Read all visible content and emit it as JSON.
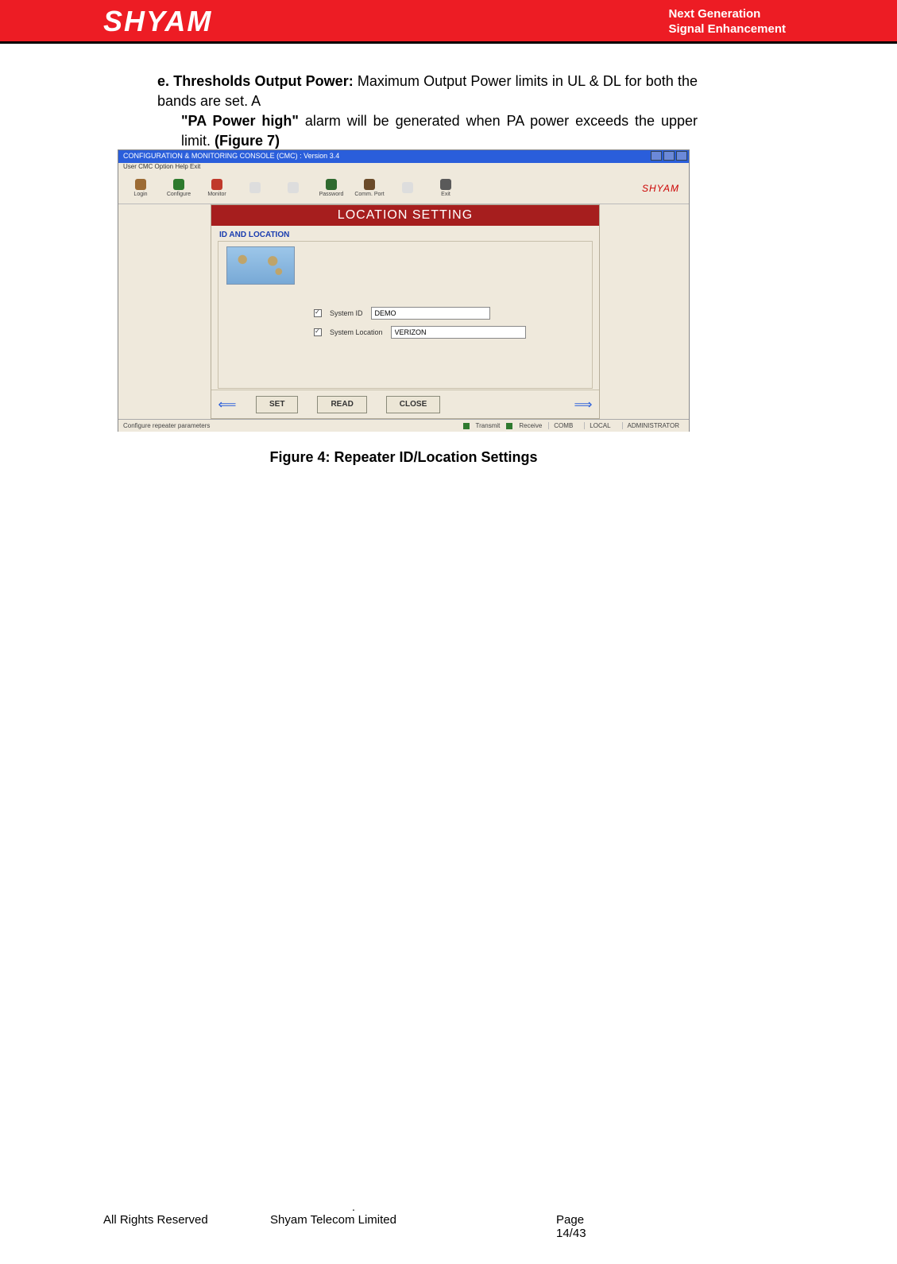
{
  "header": {
    "logo": "SHYAM",
    "tagline_l1": "Next Generation",
    "tagline_l2": "Signal Enhancement"
  },
  "paragraph": {
    "label": "e. Thresholds Output Power:",
    "body_part1": " Maximum Output Power limits in UL & DL for both the bands are set. A ",
    "alarm": "\"PA Power high\"",
    "body_part2": " alarm will be generated when PA power exceeds the upper limit. ",
    "figref": "(Figure 7)"
  },
  "screenshot": {
    "title": "CONFIGURATION & MONITORING CONSOLE (CMC)  :  Version 3.4",
    "menubar": "User  CMC  Option  Help  Exit",
    "toolbar": {
      "items": [
        "Login",
        "Configure",
        "Monitor",
        "",
        "",
        "Password",
        "Comm. Port",
        "",
        "Exit"
      ],
      "colors": [
        "#9c6b34",
        "#2d7a2d",
        "#c0392b",
        "#bbb",
        "#bbb",
        "#2f6a2f",
        "#6b4b2a",
        "#bbb",
        "#5a5a5a"
      ],
      "brand": "SHYAM"
    },
    "panel": {
      "title": "LOCATION SETTING",
      "section": "ID AND LOCATION",
      "system_id_label": "System ID",
      "system_id_value": "DEMO",
      "system_loc_label": "System Location",
      "system_loc_value": "VERIZON",
      "buttons": {
        "set": "SET",
        "read": "READ",
        "close": "CLOSE"
      }
    },
    "statusbar": {
      "msg": "Configure repeater parameters",
      "tx": "Transmit",
      "rx": "Receive",
      "mode": "COMB",
      "conn": "LOCAL",
      "role": "ADMINISTRATOR"
    }
  },
  "caption": "Figure 4: Repeater ID/Location Settings",
  "footer": {
    "dot": ".",
    "c1": "All Rights Reserved",
    "c2": "Shyam Telecom Limited",
    "c3a": "Page",
    "c3b": "14/43"
  }
}
